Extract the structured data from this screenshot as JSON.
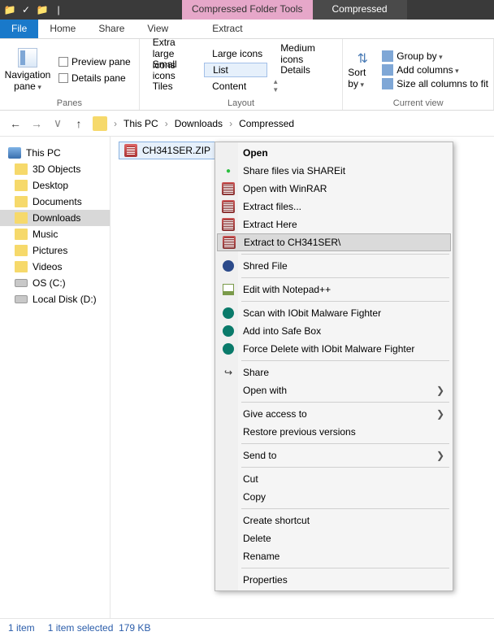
{
  "titlebar": {
    "tool_tab": "Compressed Folder Tools",
    "title": "Compressed"
  },
  "tabs": {
    "file": "File",
    "home": "Home",
    "share": "Share",
    "view": "View",
    "extract": "Extract"
  },
  "ribbon": {
    "panes": {
      "nav": "Navigation pane",
      "preview": "Preview pane",
      "details": "Details pane",
      "label": "Panes"
    },
    "layout": {
      "extra_large": "Extra large icons",
      "large": "Large icons",
      "medium": "Medium icons",
      "small": "Small icons",
      "list": "List",
      "details": "Details",
      "tiles": "Tiles",
      "content": "Content",
      "label": "Layout"
    },
    "sort": {
      "button": "Sort by",
      "group": "Group by",
      "add_columns": "Add columns",
      "size_all": "Size all columns to fit",
      "label": "Current view"
    }
  },
  "breadcrumb": {
    "root": "This PC",
    "a": "Downloads",
    "b": "Compressed"
  },
  "sidebar": {
    "items": [
      {
        "label": "This PC",
        "icon": "pc",
        "root": true
      },
      {
        "label": "3D Objects",
        "icon": "folder"
      },
      {
        "label": "Desktop",
        "icon": "folder"
      },
      {
        "label": "Documents",
        "icon": "folder"
      },
      {
        "label": "Downloads",
        "icon": "folder",
        "selected": true
      },
      {
        "label": "Music",
        "icon": "folder"
      },
      {
        "label": "Pictures",
        "icon": "folder"
      },
      {
        "label": "Videos",
        "icon": "folder"
      },
      {
        "label": "OS (C:)",
        "icon": "disk"
      },
      {
        "label": "Local Disk (D:)",
        "icon": "disk"
      }
    ]
  },
  "file": {
    "name": "CH341SER.ZIP"
  },
  "context_menu": {
    "open": "Open",
    "shareit": "Share files via SHAREit",
    "open_winrar": "Open with WinRAR",
    "extract_files": "Extract files...",
    "extract_here": "Extract Here",
    "extract_to": "Extract to CH341SER\\",
    "shred": "Shred File",
    "notepad": "Edit with Notepad++",
    "scan_iobit": "Scan with IObit Malware Fighter",
    "safe_box": "Add into Safe Box",
    "force_delete": "Force Delete with IObit Malware Fighter",
    "share": "Share",
    "open_with": "Open with",
    "give_access": "Give access to",
    "restore": "Restore previous versions",
    "send_to": "Send to",
    "cut": "Cut",
    "copy": "Copy",
    "shortcut": "Create shortcut",
    "delete": "Delete",
    "rename": "Rename",
    "properties": "Properties"
  },
  "status": {
    "count": "1 item",
    "selected": "1 item selected",
    "size": "179 KB"
  }
}
